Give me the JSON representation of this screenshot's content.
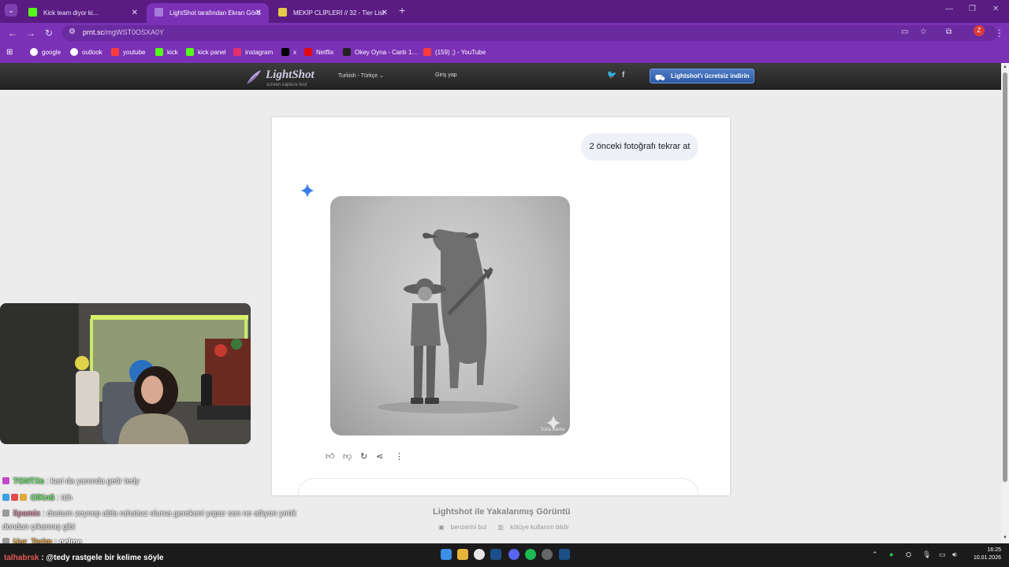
{
  "browser": {
    "tabs": [
      {
        "title": "Kick team diyor ki...",
        "favicon_color": "#53fc18"
      },
      {
        "title": "LightShot tarafından Ekran Görü",
        "favicon_color": "#a77bdb"
      },
      {
        "title": "MEKİP CLİPLERİ // 32 - Tier List",
        "favicon_color": "#e4c94a"
      }
    ],
    "url_host": "prnt.sc",
    "url_path": "/mgWST0OSXA0Y",
    "profile_initial": "Z",
    "bookmarks": [
      {
        "label": "google",
        "color": "#ffffff"
      },
      {
        "label": "outlook",
        "color": "#ffffff"
      },
      {
        "label": "youtube",
        "color": "#ff3b3b"
      },
      {
        "label": "kick",
        "color": "#53fc18"
      },
      {
        "label": "kick panel",
        "color": "#53fc18"
      },
      {
        "label": "instagram",
        "color": "#e1306c"
      },
      {
        "label": "x",
        "color": "#000000"
      },
      {
        "label": "Netflix",
        "color": "#e50914"
      },
      {
        "label": "Okey Oyna - Canlı 1...",
        "color": "#222222"
      },
      {
        "label": "(159) ;) - YouTube",
        "color": "#ff3b3b"
      }
    ]
  },
  "lightshot": {
    "logo_title": "LightShot",
    "logo_subtitle": "screen capture tool",
    "language": "Turkish - Türkçe",
    "login": "Giriş yap",
    "download_label": "Lightshot'ı ücretsiz indirin",
    "footer_title": "Lightshot ile Yakalanmış Görüntü",
    "footer_link_similar": "benzerini bul",
    "footer_link_report": "kötüye kullanım bildir"
  },
  "screenshot": {
    "prompt": "2 önceki fotoğrafı tekrar at",
    "image_watermark": "Tuna Sleins"
  },
  "stream_chat": [
    {
      "user": "TONTXs",
      "user_color": "#6be86b",
      "message": ": kari da yanında getir tedy"
    },
    {
      "user": "OlKnS",
      "user_color": "#6be86b",
      "message": ": tüh"
    },
    {
      "user": "lipamic",
      "user_color": "#d08aa0",
      "message": ": dostum zeynep abla rahatsız olursa gerekeni yapar sen ne atlıyon yırtık"
    },
    {
      "user": "",
      "user_color": "#ffffff",
      "message": "dondan çıkarmış gibi"
    },
    {
      "user": "Uur_Terim",
      "user_color": "#e7a13c",
      "message": ": gelme"
    }
  ],
  "chat_input": {
    "user": "talhabrsk",
    "message": ": @tedy rastgele bir kelime söyle"
  },
  "taskbar": {
    "time": "16:25",
    "date": "10.01.2026"
  }
}
